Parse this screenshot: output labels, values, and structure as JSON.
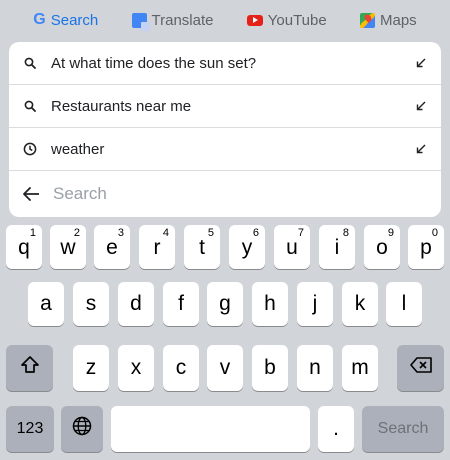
{
  "top_bar": {
    "links": [
      {
        "label": "Search",
        "icon": "google-g-icon"
      },
      {
        "label": "Translate",
        "icon": "translate-icon"
      },
      {
        "label": "YouTube",
        "icon": "youtube-icon"
      },
      {
        "label": "Maps",
        "icon": "maps-icon"
      }
    ],
    "google_letter": "G",
    "accent": "#1a73e8"
  },
  "suggestions": [
    {
      "text": "At what time does the sun set?",
      "icon": "search-icon"
    },
    {
      "text": "Restaurants near me",
      "icon": "search-icon"
    },
    {
      "text": "weather",
      "icon": "history-icon"
    }
  ],
  "search": {
    "placeholder": "Search",
    "value": ""
  },
  "keyboard": {
    "row1": [
      {
        "key": "q",
        "hint": "1"
      },
      {
        "key": "w",
        "hint": "2"
      },
      {
        "key": "e",
        "hint": "3"
      },
      {
        "key": "r",
        "hint": "4"
      },
      {
        "key": "t",
        "hint": "5"
      },
      {
        "key": "y",
        "hint": "6"
      },
      {
        "key": "u",
        "hint": "7"
      },
      {
        "key": "i",
        "hint": "8"
      },
      {
        "key": "o",
        "hint": "9"
      },
      {
        "key": "p",
        "hint": "0"
      }
    ],
    "row2": [
      "a",
      "s",
      "d",
      "f",
      "g",
      "h",
      "j",
      "k",
      "l"
    ],
    "row3": [
      "z",
      "x",
      "c",
      "v",
      "b",
      "n",
      "m"
    ],
    "numbers_label": "123",
    "period_label": ".",
    "search_label": "Search"
  }
}
